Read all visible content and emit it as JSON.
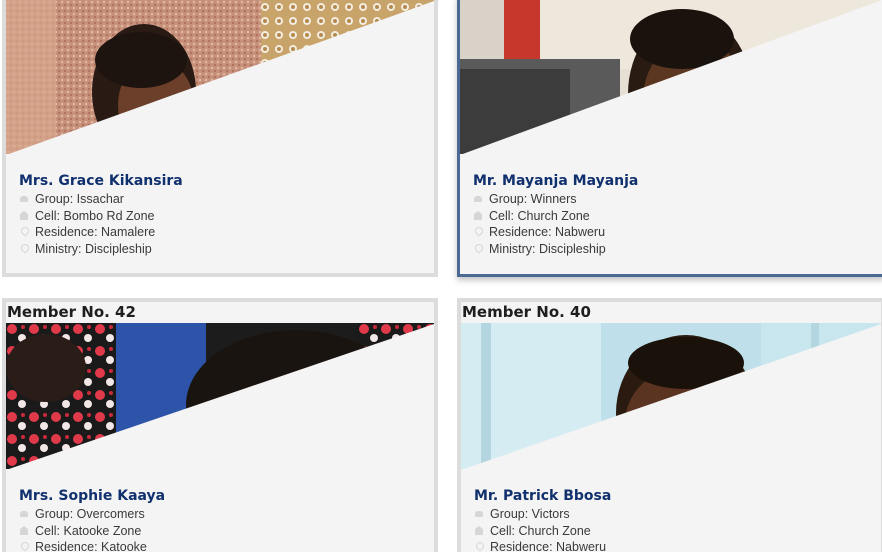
{
  "cards": [
    {
      "member_no": "",
      "name": "Mrs. Grace Kikansira",
      "group": "Group: Issachar",
      "cell": "Cell: Bombo Rd Zone",
      "residence": "Residence: Namalere",
      "ministry": "Ministry: Discipleship"
    },
    {
      "member_no": "",
      "name": "Mr. Mayanja Mayanja",
      "group": "Group: Winners",
      "cell": "Cell: Church Zone",
      "residence": "Residence: Nabweru",
      "ministry": "Ministry: Discipleship"
    },
    {
      "member_no": "Member No. 42",
      "name": "Mrs. Sophie Kaaya",
      "group": "Group: Overcomers",
      "cell": "Cell: Katooke Zone",
      "residence": "Residence: Katooke",
      "ministry": ""
    },
    {
      "member_no": "Member No. 40",
      "name": "Mr. Patrick Bbosa",
      "group": "Group: Victors",
      "cell": "Cell: Church Zone",
      "residence": "Residence: Nabweru",
      "ministry": ""
    }
  ],
  "icons": {
    "group": "group-icon",
    "cell": "home-icon",
    "residence": "map-pin-icon",
    "ministry": "ministry-icon"
  },
  "colors": {
    "name": "#10306e",
    "active_border": "#4a6a94",
    "card_bg": "#f4f4f4"
  }
}
